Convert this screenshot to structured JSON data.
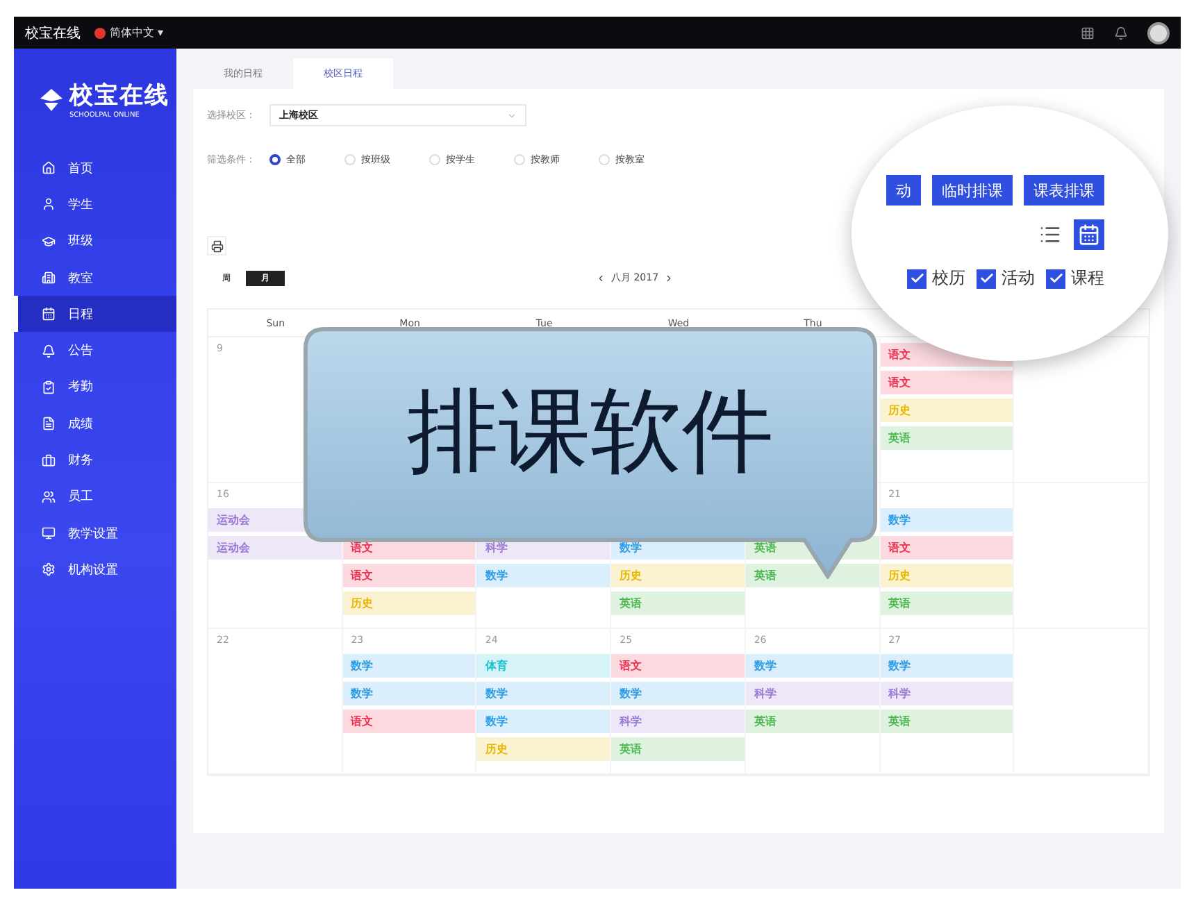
{
  "top_bar": {
    "brand": "校宝在线",
    "language": "简体中文 ▾"
  },
  "sidebar": {
    "logo": "校宝在线",
    "logo_sub": "SCHOOLPAL ONLINE",
    "items": [
      {
        "label": "首页",
        "selected": false
      },
      {
        "label": "学生",
        "selected": false
      },
      {
        "label": "班级",
        "selected": false
      },
      {
        "label": "教室",
        "selected": false
      },
      {
        "label": "日程",
        "selected": true
      },
      {
        "label": "公告",
        "selected": false
      },
      {
        "label": "考勤",
        "selected": false
      },
      {
        "label": "成绩",
        "selected": false
      },
      {
        "label": "财务",
        "selected": false
      },
      {
        "label": "员工",
        "selected": false
      },
      {
        "label": "教学设置",
        "selected": false
      },
      {
        "label": "机构设置",
        "selected": false
      }
    ]
  },
  "tabs": [
    {
      "label": "我的日程",
      "selected": false
    },
    {
      "label": "校区日程",
      "selected": true
    }
  ],
  "campus": {
    "label": "选择校区：",
    "value": "上海校区"
  },
  "filter": {
    "label": "筛选条件：",
    "options": [
      {
        "label": "全部",
        "selected": true
      },
      {
        "label": "按班级",
        "selected": false
      },
      {
        "label": "按学生",
        "selected": false
      },
      {
        "label": "按教师",
        "selected": false
      },
      {
        "label": "按教室",
        "selected": false
      }
    ]
  },
  "view_modes": [
    {
      "label": "周",
      "selected": false
    },
    {
      "label": "月",
      "selected": true
    }
  ],
  "month": "八月 2017",
  "magnifier": {
    "buttons": [
      "动",
      "临时排课",
      "课表排课"
    ],
    "layouts": [
      {
        "kind": "list",
        "selected": false
      },
      {
        "kind": "calendar",
        "selected": true
      }
    ],
    "checks": [
      {
        "label": "校历",
        "checked": true
      },
      {
        "label": "活动",
        "checked": true
      },
      {
        "label": "课程",
        "checked": true
      }
    ]
  },
  "calendar": {
    "weekdays": [
      "Sun",
      "Mon",
      "Tue",
      "Wed",
      "Thu"
    ],
    "weeks": [
      {
        "days": [
          {
            "kind": "day",
            "date": "9"
          },
          {
            "kind": "blank"
          },
          {
            "kind": "blank"
          },
          {
            "kind": "blank"
          },
          {
            "kind": "blank"
          },
          {
            "kind": "day",
            "events": [
              {
                "label": "语文",
                "color": "#f0304f"
              },
              {
                "label": "语文",
                "color": "#f0304f"
              },
              {
                "label": "历史",
                "color": "#e8b800"
              },
              {
                "label": "英语",
                "color": "#4cb850"
              }
            ]
          },
          {
            "kind": "blank"
          }
        ]
      },
      {
        "days": [
          {
            "kind": "day",
            "date": "16",
            "events": [
              {
                "label": "运动会",
                "color": "#9a7ad6"
              },
              {
                "label": "运动会",
                "color": "#9a7ad6"
              }
            ]
          },
          {
            "kind": "day",
            "offset": true,
            "events": [
              {
                "label": "语文",
                "color": "#f0304f"
              },
              {
                "label": "语文",
                "color": "#f0304f"
              },
              {
                "label": "历史",
                "color": "#e8b800"
              }
            ]
          },
          {
            "kind": "day",
            "offset": true,
            "events": [
              {
                "label": "科学",
                "color": "#9a7ad6"
              },
              {
                "label": "数学",
                "color": "#2f9ee6"
              }
            ]
          },
          {
            "kind": "day",
            "offset": true,
            "events": [
              {
                "label": "数学",
                "color": "#2f9ee6"
              },
              {
                "label": "历史",
                "color": "#e8b800"
              },
              {
                "label": "英语",
                "color": "#4cb850"
              }
            ]
          },
          {
            "kind": "day",
            "offset": true,
            "events": [
              {
                "label": "英语",
                "color": "#4cb850"
              },
              {
                "label": "英语",
                "color": "#4cb850"
              }
            ]
          },
          {
            "kind": "day",
            "date": "21",
            "events": [
              {
                "label": "数学",
                "color": "#2f9ee6"
              },
              {
                "label": "语文",
                "color": "#f0304f"
              },
              {
                "label": "历史",
                "color": "#e8b800"
              },
              {
                "label": "英语",
                "color": "#4cb850"
              }
            ]
          },
          {
            "kind": "blank"
          }
        ]
      },
      {
        "days": [
          {
            "kind": "day",
            "date": "22"
          },
          {
            "kind": "day",
            "date": "23",
            "events": [
              {
                "label": "数学",
                "color": "#2f9ee6"
              },
              {
                "label": "数学",
                "color": "#2f9ee6"
              },
              {
                "label": "语文",
                "color": "#f0304f"
              }
            ]
          },
          {
            "kind": "day",
            "date": "24",
            "events": [
              {
                "label": "体育",
                "color": "#1cc3d1"
              },
              {
                "label": "数学",
                "color": "#2f9ee6"
              },
              {
                "label": "数学",
                "color": "#2f9ee6"
              },
              {
                "label": "历史",
                "color": "#e8b800"
              }
            ]
          },
          {
            "kind": "day",
            "date": "25",
            "events": [
              {
                "label": "语文",
                "color": "#f0304f"
              },
              {
                "label": "数学",
                "color": "#2f9ee6"
              },
              {
                "label": "科学",
                "color": "#9a7ad6"
              },
              {
                "label": "英语",
                "color": "#4cb850"
              }
            ]
          },
          {
            "kind": "day",
            "date": "26",
            "events": [
              {
                "label": "数学",
                "color": "#2f9ee6"
              },
              {
                "label": "科学",
                "color": "#9a7ad6"
              },
              {
                "label": "英语",
                "color": "#4cb850"
              }
            ]
          },
          {
            "kind": "day",
            "date": "27",
            "events": [
              {
                "label": "数学",
                "color": "#2f9ee6"
              },
              {
                "label": "科学",
                "color": "#9a7ad6"
              },
              {
                "label": "英语",
                "color": "#4cb850"
              }
            ]
          },
          {
            "kind": "blank"
          }
        ]
      }
    ]
  },
  "callout": "排课软件"
}
